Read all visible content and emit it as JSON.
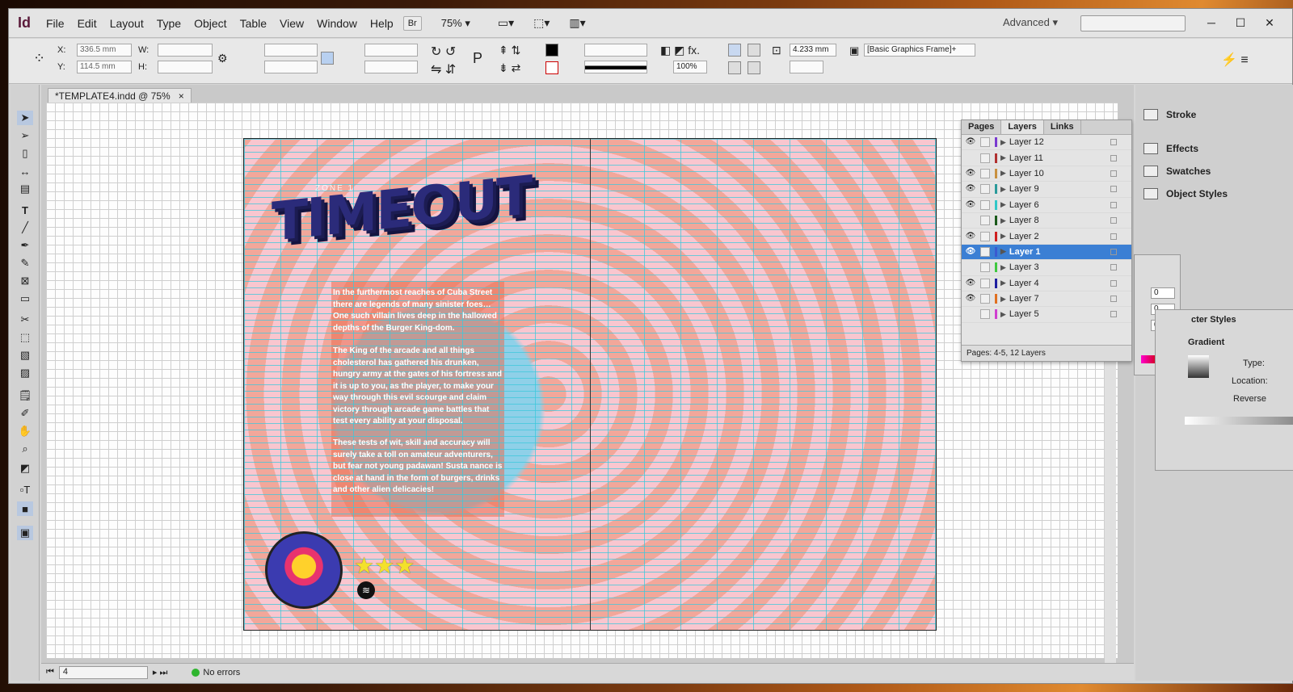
{
  "app": {
    "logo": "Id"
  },
  "menu": {
    "items": [
      "File",
      "Edit",
      "Layout",
      "Type",
      "Object",
      "Table",
      "View",
      "Window",
      "Help"
    ],
    "bridge": "Br",
    "zoom": "75%",
    "workspace": "Advanced"
  },
  "control": {
    "x_label": "X:",
    "x_value": "336.5 mm",
    "y_label": "Y:",
    "y_value": "114.5 mm",
    "w_label": "W:",
    "h_label": "H:",
    "scale": "100%",
    "stroke_weight": "4.233 mm",
    "frame_style": "[Basic Graphics Frame]+"
  },
  "doc": {
    "tab": "*TEMPLATE4.indd @ 75%",
    "close": "×"
  },
  "spread": {
    "zone": "ZONE 1",
    "title": "TIMEOUT",
    "para1": "In the furthermost reaches of Cuba Street there are legends of many sinister foes… One such villain lives deep in the hallowed depths of the Burger King-dom.",
    "para2": "The King of the arcade and all things cholesterol has gathered his drunken, hungry army at the gates of his fortress and it is up to you, as the player, to make your way through this evil scourge and claim victory through arcade game battles that test every ability at your disposal.",
    "para3": "These tests of wit, skill and accuracy will surely take a toll on amateur adventurers, but fear not young padawan! Susta nance is close at hand in the form of burgers, drinks and other alien delicacies!",
    "stars": "★★★"
  },
  "status": {
    "page": "4",
    "errors": "No errors"
  },
  "right_panel": {
    "items": [
      "Stroke",
      "Effects",
      "Swatches",
      "Object Styles"
    ]
  },
  "layers_panel": {
    "tabs": [
      "Pages",
      "Layers",
      "Links"
    ],
    "layers": [
      {
        "name": "Layer 12",
        "visible": true,
        "color": "#7a3ad0"
      },
      {
        "name": "Layer 11",
        "visible": false,
        "color": "#b03030"
      },
      {
        "name": "Layer 10",
        "visible": true,
        "color": "#c89040"
      },
      {
        "name": "Layer 9",
        "visible": true,
        "color": "#2a9a9a"
      },
      {
        "name": "Layer 6",
        "visible": true,
        "color": "#30c8c8"
      },
      {
        "name": "Layer 8",
        "visible": false,
        "color": "#1a5a1a"
      },
      {
        "name": "Layer 2",
        "visible": true,
        "color": "#d02020"
      },
      {
        "name": "Layer 1",
        "visible": true,
        "color": "#3a5ad0",
        "selected": true
      },
      {
        "name": "Layer 3",
        "visible": false,
        "color": "#40c840"
      },
      {
        "name": "Layer 4",
        "visible": true,
        "color": "#2020a0"
      },
      {
        "name": "Layer 7",
        "visible": true,
        "color": "#e07020"
      },
      {
        "name": "Layer 5",
        "visible": false,
        "color": "#d040d0"
      }
    ],
    "footer": "Pages: 4-5, 12 Layers"
  },
  "color_panel": {
    "values": [
      "0",
      "0",
      "0"
    ]
  },
  "gradient_panel": {
    "title": "Gradient",
    "styles_label": "cter Styles",
    "type_label": "Type:",
    "location_label": "Location:",
    "reverse_label": "Reverse"
  }
}
